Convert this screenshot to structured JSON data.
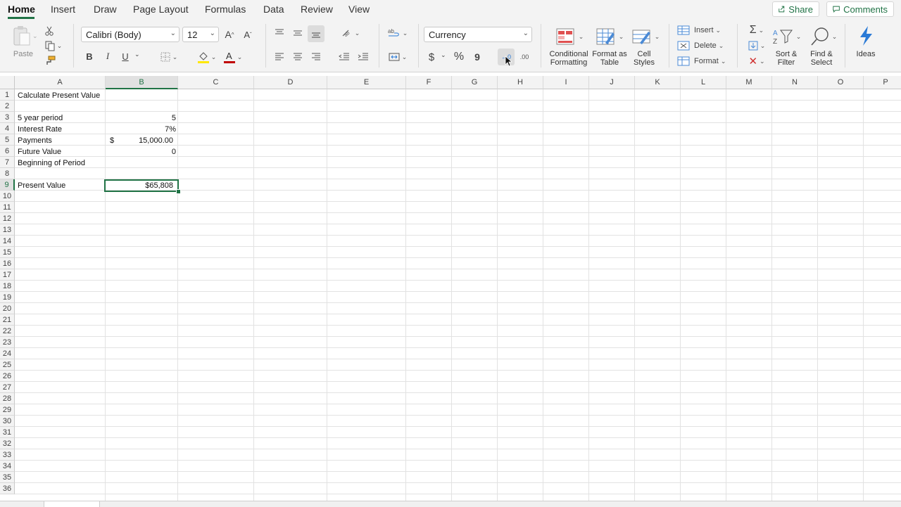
{
  "menu_tabs": [
    "Home",
    "Insert",
    "Draw",
    "Page Layout",
    "Formulas",
    "Data",
    "Review",
    "View"
  ],
  "top_buttons": {
    "share": "Share",
    "comments": "Comments"
  },
  "clipboard": {
    "paste": "Paste"
  },
  "font": {
    "name": "Calibri (Body)",
    "size": "12"
  },
  "format": {
    "B": "B",
    "I": "I",
    "U": "U",
    "dollar": "$",
    "percent": "%",
    "comma": "9",
    "dec_inc": "←0",
    "dec_dec": ".00"
  },
  "number_format": "Currency",
  "styles": {
    "conditional": "Conditional Formatting",
    "format_table": "Format as Table",
    "cell_styles": "Cell Styles"
  },
  "cells_group": {
    "insert": "Insert",
    "delete": "Delete",
    "format": "Format"
  },
  "editing": {
    "sort": "Sort & Filter",
    "find": "Find & Select",
    "ideas": "Ideas"
  },
  "columns": [
    "A",
    "B",
    "C",
    "D",
    "E",
    "F",
    "G",
    "H",
    "I",
    "J",
    "K",
    "L",
    "M",
    "N",
    "O",
    "P"
  ],
  "rows": [
    "1",
    "2",
    "3",
    "4",
    "5",
    "6",
    "7",
    "8",
    "9",
    "10",
    "11",
    "12",
    "13",
    "14",
    "15",
    "16",
    "17",
    "18",
    "19",
    "20",
    "21",
    "22",
    "23",
    "24",
    "25",
    "26",
    "27",
    "28",
    "29",
    "30",
    "31",
    "32",
    "33",
    "34",
    "35",
    "36"
  ],
  "cells": {
    "A1": "Calculate Present Value",
    "A3": "5 year period",
    "B3": "5",
    "A4": "Interest Rate",
    "B4": "7%",
    "A5": "Payments",
    "B5_symbol": "$",
    "B5": "15,000.00",
    "A6": "Future Value",
    "B6": "0",
    "A7": "Beginning of Period",
    "A9": "Present Value",
    "B9": "$65,808"
  },
  "selected_cell": "B9",
  "colors": {
    "accent": "#217346",
    "font_red": "#c00000",
    "fill_yellow": "#ffe800"
  }
}
